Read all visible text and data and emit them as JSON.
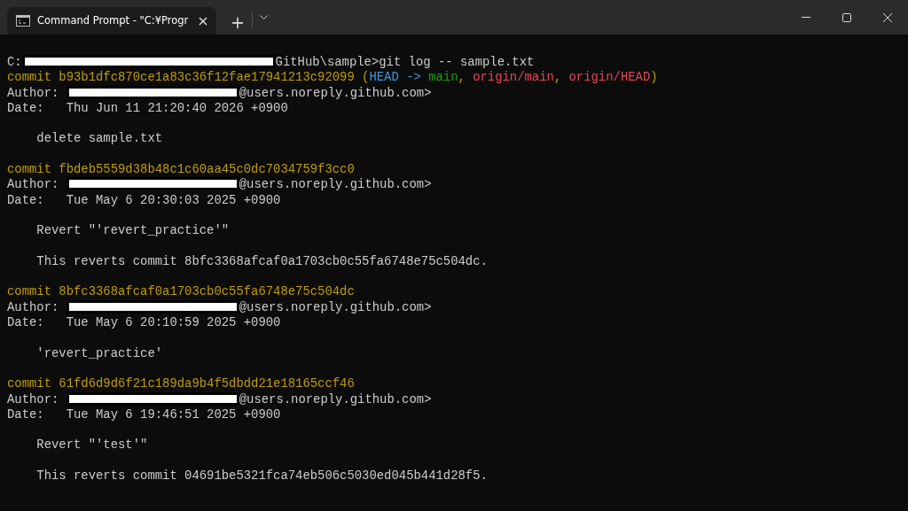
{
  "window": {
    "tab": {
      "title": "Command Prompt - \"C:¥Progr",
      "selected": true,
      "close": "×"
    },
    "new_tab": "+"
  },
  "lines": [
    {
      "kind": "prompt",
      "segments": [
        {
          "text": "C:",
          "color": "#cccccc"
        },
        {
          "kind": "redacted"
        },
        {
          "text": "GitHub\\sample>git log -- sample.txt",
          "color": "#cccccc"
        }
      ]
    },
    {
      "segments": [
        {
          "text": "commit b93b1dfc870ce1a83c36f12fae17941213c92099 (",
          "color": "#c19c00"
        },
        {
          "text": "HEAD -> ",
          "color": "#3a96dd"
        },
        {
          "text": "main",
          "color": "#13a10e"
        },
        {
          "text": ", ",
          "color": "#c19c00"
        },
        {
          "text": "origin/main",
          "color": "#e74856"
        },
        {
          "text": ", ",
          "color": "#c19c00"
        },
        {
          "text": "origin/HEAD",
          "color": "#e74856"
        },
        {
          "text": ")",
          "color": "#c19c00"
        }
      ]
    },
    {
      "segments": [
        {
          "text": "Author: ",
          "color": "#cccccc"
        },
        {
          "kind": "redacted"
        },
        {
          "text": "@users.noreply.github.com>",
          "color": "#cccccc"
        }
      ]
    },
    {
      "segments": [
        {
          "text": "Date:   Thu Jun 11 21:20:40 2026 +0900",
          "color": "#cccccc"
        }
      ]
    },
    {
      "kind": "blank"
    },
    {
      "segments": [
        {
          "text": "    delete sample.txt",
          "color": "#cccccc"
        }
      ]
    },
    {
      "kind": "blank"
    },
    {
      "segments": [
        {
          "text": "commit fbdeb5559d38b48c1c60aa45c0dc7034759f3cc0",
          "color": "#c19c00"
        }
      ]
    },
    {
      "segments": [
        {
          "text": "Author: ",
          "color": "#cccccc"
        },
        {
          "kind": "redacted"
        },
        {
          "text": "@users.noreply.github.com>",
          "color": "#cccccc"
        }
      ]
    },
    {
      "segments": [
        {
          "text": "Date:   Tue May 6 20:30:03 2025 +0900",
          "color": "#cccccc"
        }
      ]
    },
    {
      "kind": "blank"
    },
    {
      "segments": [
        {
          "text": "    Revert \"'revert_practice'\"",
          "color": "#cccccc"
        }
      ]
    },
    {
      "kind": "blank"
    },
    {
      "segments": [
        {
          "text": "    This reverts commit 8bfc3368afcaf0a1703cb0c55fa6748e75c504dc.",
          "color": "#cccccc"
        }
      ]
    },
    {
      "kind": "blank"
    },
    {
      "segments": [
        {
          "text": "commit 8bfc3368afcaf0a1703cb0c55fa6748e75c504dc",
          "color": "#c19c00"
        }
      ]
    },
    {
      "segments": [
        {
          "text": "Author: ",
          "color": "#cccccc"
        },
        {
          "kind": "redacted"
        },
        {
          "text": "@users.noreply.github.com>",
          "color": "#cccccc"
        }
      ]
    },
    {
      "segments": [
        {
          "text": "Date:   Tue May 6 20:10:59 2025 +0900",
          "color": "#cccccc"
        }
      ]
    },
    {
      "kind": "blank"
    },
    {
      "segments": [
        {
          "text": "    'revert_practice'",
          "color": "#cccccc"
        }
      ]
    },
    {
      "kind": "blank"
    },
    {
      "segments": [
        {
          "text": "commit 61fd6d9d6f21c189da9b4f5dbdd21e18165ccf46",
          "color": "#c19c00"
        }
      ]
    },
    {
      "segments": [
        {
          "text": "Author: ",
          "color": "#cccccc"
        },
        {
          "kind": "redacted"
        },
        {
          "text": "@users.noreply.github.com>",
          "color": "#cccccc"
        }
      ]
    },
    {
      "segments": [
        {
          "text": "Date:   Tue May 6 19:46:51 2025 +0900",
          "color": "#cccccc"
        }
      ]
    },
    {
      "kind": "blank"
    },
    {
      "segments": [
        {
          "text": "    Revert \"'test'\"",
          "color": "#cccccc"
        }
      ]
    },
    {
      "kind": "blank"
    },
    {
      "segments": [
        {
          "text": "    This reverts commit 04691be5321fca74eb506c5030ed045b441d28f5.",
          "color": "#cccccc"
        }
      ]
    }
  ]
}
